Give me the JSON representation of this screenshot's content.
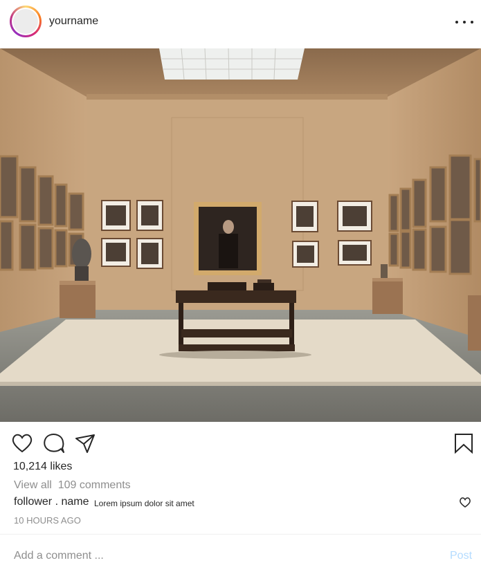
{
  "header": {
    "username": "yourname",
    "avatar": "profile-avatar",
    "more_icon": "more-horizontal-icon"
  },
  "photo": {
    "subject": "gallery room with framed pictures and central table",
    "colors": {
      "wall": "#c6a27e",
      "floor": "#8f8d84",
      "rug": "#e6dccb",
      "table": "#3b2a1f"
    }
  },
  "actions": {
    "like_icon": "heart-icon",
    "comment_icon": "comment-bubble-icon",
    "share_icon": "send-icon",
    "save_icon": "bookmark-icon"
  },
  "likes_text": "10,214 likes",
  "view_all_text": "View all  109 comments",
  "comment": {
    "user": "follower . name",
    "text": "Lorem ipsum dolor sit amet"
  },
  "timestamp": "10 HOURS AGO",
  "composer": {
    "placeholder": "Add a comment ...",
    "post_label": "Post"
  },
  "colors": {
    "text": "#262626",
    "muted": "#8e8e8e",
    "post_disabled": "#b3dbff"
  }
}
